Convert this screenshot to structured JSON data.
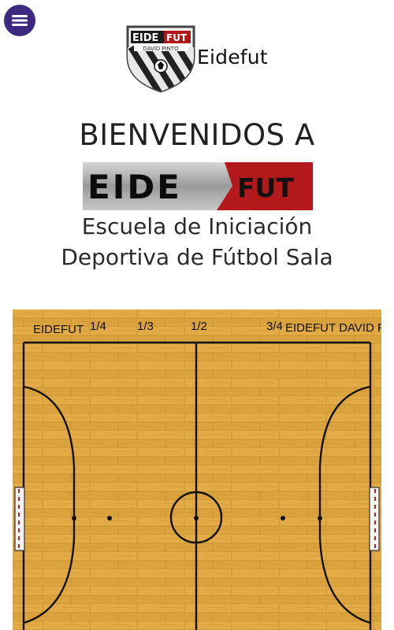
{
  "header": {
    "menu_icon": "hamburger-menu-icon",
    "brand_name": "Eidefut",
    "logo_top_text": "EIDE",
    "logo_top_accent": "FUT",
    "logo_sub_text": "DAVID PINTO"
  },
  "hero": {
    "welcome": "BIENVENIDOS A",
    "banner_left": "EIDE",
    "banner_right": "FUT",
    "subtitle_line1": "Escuela de Iniciación",
    "subtitle_line2": "Deportiva de Fútbol Sala"
  },
  "court": {
    "labels": {
      "left_club": "EIDEFUT",
      "quarter": "1/4",
      "third": "1/3",
      "half": "1/2",
      "three_quarter": "3/4",
      "right_club": "EIDEFUT DAVID PINTO"
    }
  },
  "colors": {
    "menu_button": "#3b2a80",
    "logo_red": "#b01818",
    "court_wood": "#d9a13c",
    "court_lines": "#111111"
  }
}
